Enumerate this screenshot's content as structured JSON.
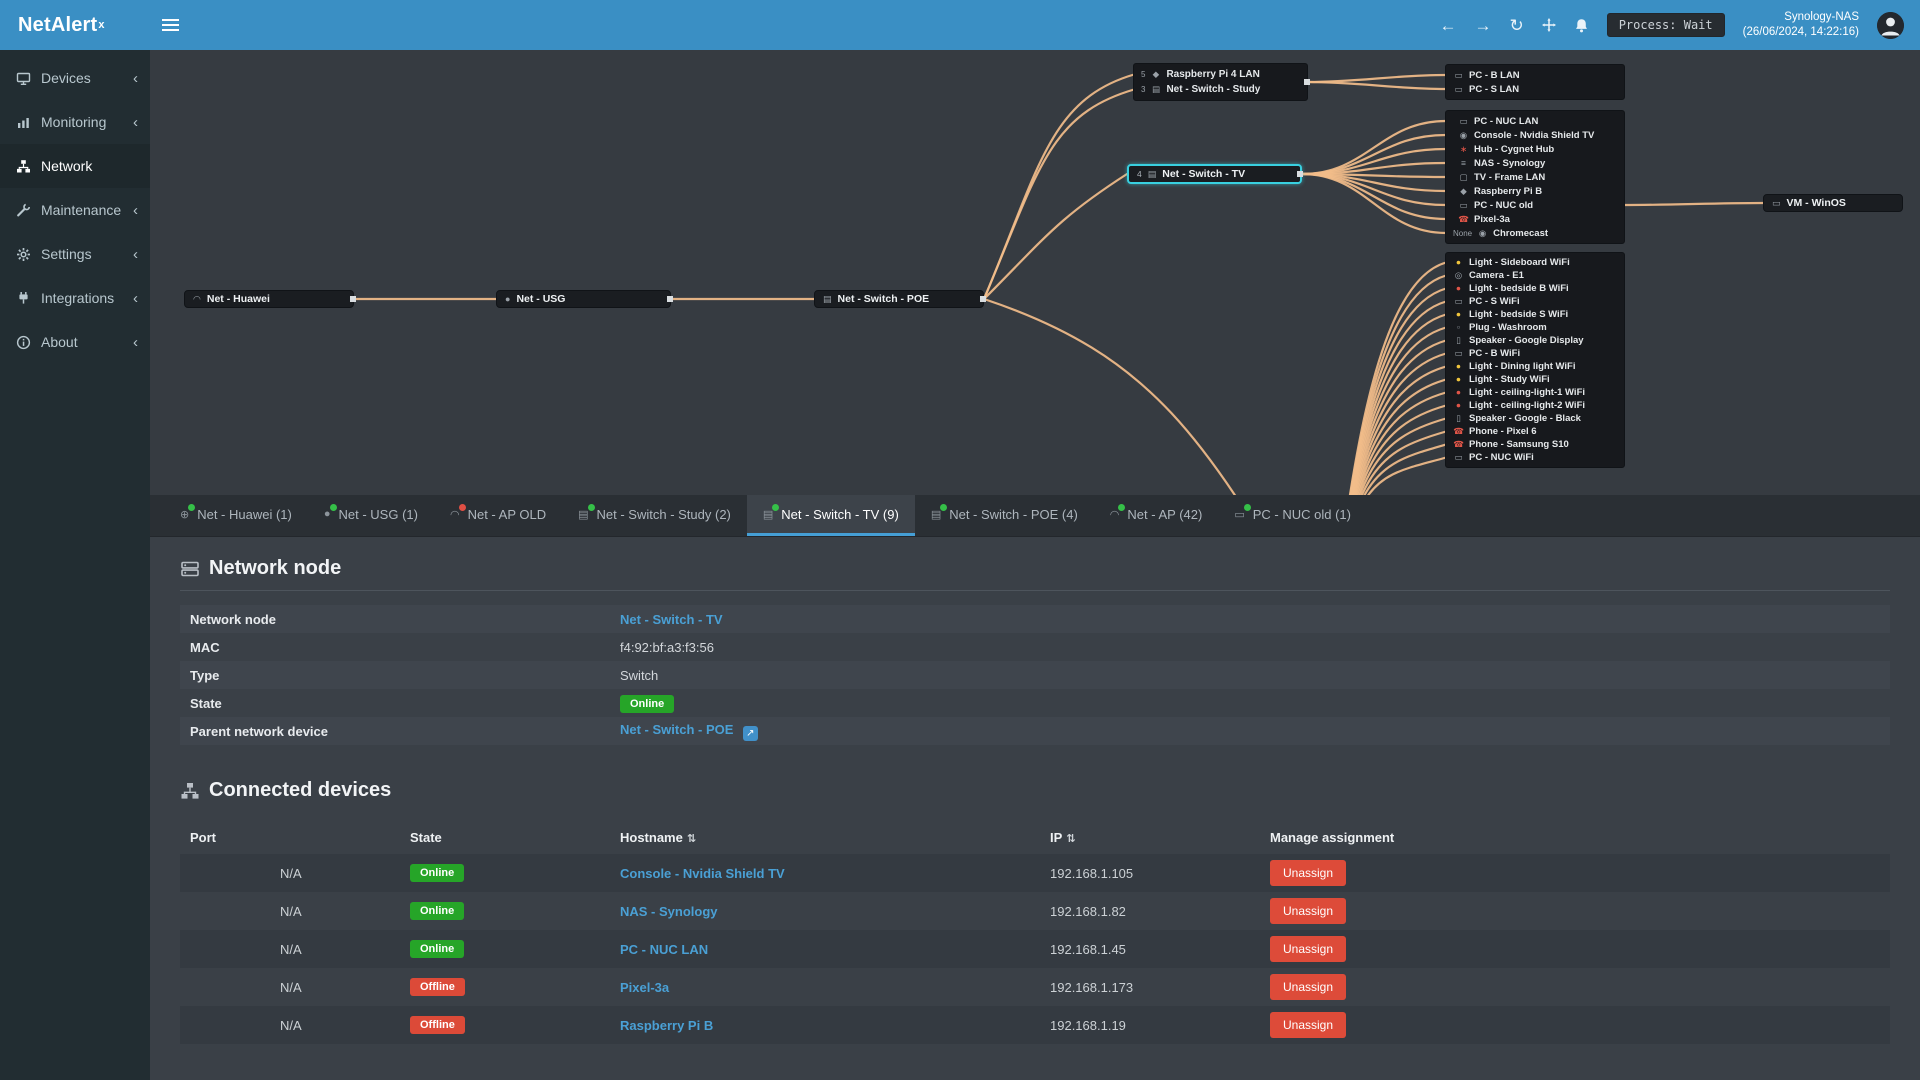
{
  "app": {
    "brand": "NetAlert",
    "brand_sup": "x"
  },
  "topbar": {
    "process_badge": "Process: Wait",
    "server_name": "Synology-NAS",
    "server_time": "(26/06/2024, 14:22:16)"
  },
  "colors": {
    "accent_blue": "#3a8fc4",
    "link": "#4aa0d5",
    "online": "#26a528",
    "offline": "#dc4a38",
    "topology_line": "#f2bd8a",
    "selected_node": "#39d0e0",
    "dot_green": "#35c048",
    "dot_red": "#e04f44"
  },
  "sidebar": {
    "items": [
      {
        "label": "Devices"
      },
      {
        "label": "Monitoring"
      },
      {
        "label": "Network"
      },
      {
        "label": "Maintenance"
      },
      {
        "label": "Settings"
      },
      {
        "label": "Integrations"
      },
      {
        "label": "About"
      }
    ]
  },
  "diagram": {
    "nodes": {
      "huawei": {
        "label": "Net - Huawei"
      },
      "usg": {
        "label": "Net - USG"
      },
      "poe": {
        "label": "Net - Switch - POE"
      },
      "tv": {
        "label": "Net - Switch - TV",
        "port": "4"
      },
      "vm": {
        "label": "VM - WinOS"
      }
    },
    "study_group": [
      {
        "port": "5",
        "label": "Raspberry Pi 4 LAN",
        "icon_class": "ic-pi"
      },
      {
        "port": "3",
        "label": "Net - Switch - Study",
        "icon_class": "ic-switch"
      }
    ],
    "lan_top_group": [
      {
        "label": "PC - B LAN",
        "icon_class": "ic-pc"
      },
      {
        "label": "PC - S LAN",
        "icon_class": "ic-pc"
      }
    ],
    "tv_group": [
      {
        "label": "PC - NUC LAN",
        "icon_class": "ic-pc"
      },
      {
        "label": "Console - Nvidia Shield TV",
        "icon_class": "ic-cast"
      },
      {
        "label": "Hub - Cygnet Hub",
        "icon_class": "ic-hub"
      },
      {
        "label": "NAS - Synology",
        "icon_class": "ic-nas"
      },
      {
        "label": "TV - Frame LAN",
        "icon_class": "ic-tv"
      },
      {
        "label": "Raspberry Pi B",
        "icon_class": "ic-pi"
      },
      {
        "label": "PC - NUC old",
        "icon_class": "ic-pc"
      },
      {
        "label": "Pixel-3a",
        "icon_class": "ic-phone-red"
      },
      {
        "port": "None",
        "label": "Chromecast",
        "icon_class": "ic-cast"
      }
    ],
    "ap_group": [
      {
        "label": "Light - Sideboard WiFi",
        "icon_class": "ic-bulb-yellow"
      },
      {
        "label": "Camera - E1",
        "icon_class": "ic-camera"
      },
      {
        "label": "Light - bedside B WiFi",
        "icon_class": "ic-bulb-red"
      },
      {
        "label": "PC - S WiFi",
        "icon_class": "ic-pc"
      },
      {
        "label": "Light - bedside S WiFi",
        "icon_class": "ic-bulb-yellow"
      },
      {
        "label": "Plug - Washroom",
        "icon_class": "ic-plug"
      },
      {
        "label": "Speaker - Google Display",
        "icon_class": "ic-speaker"
      },
      {
        "label": "PC - B WiFi",
        "icon_class": "ic-pc"
      },
      {
        "label": "Light - Dining light WiFi",
        "icon_class": "ic-bulb-yellow"
      },
      {
        "label": "Light - Study WiFi",
        "icon_class": "ic-bulb-yellow"
      },
      {
        "label": "Light - ceiling-light-1 WiFi",
        "icon_class": "ic-bulb-red"
      },
      {
        "label": "Light - ceiling-light-2 WiFi",
        "icon_class": "ic-bulb-red"
      },
      {
        "label": "Speaker - Google - Black",
        "icon_class": "ic-speaker"
      },
      {
        "label": "Phone - Pixel 6",
        "icon_class": "ic-phone-red"
      },
      {
        "label": "Phone - Samsung S10",
        "icon_class": "ic-phone-red"
      },
      {
        "label": "PC - NUC WiFi",
        "icon_class": "ic-pc"
      }
    ]
  },
  "tabs": [
    {
      "label": "Net - Huawei (1)",
      "dot": "green"
    },
    {
      "label": "Net - USG (1)",
      "dot": "green"
    },
    {
      "label": "Net - AP OLD",
      "dot": "red"
    },
    {
      "label": "Net - Switch - Study (2)",
      "dot": "green"
    },
    {
      "label": "Net - Switch - TV (9)",
      "dot": "green"
    },
    {
      "label": "Net - Switch - POE (4)",
      "dot": "green"
    },
    {
      "label": "Net - AP (42)",
      "dot": "green"
    },
    {
      "label": "PC - NUC old (1)",
      "dot": "green"
    }
  ],
  "node_section": {
    "title": "Network node",
    "fields": [
      {
        "label": "Network node",
        "value": "Net - Switch - TV"
      },
      {
        "label": "MAC",
        "value": "f4:92:bf:a3:f3:56"
      },
      {
        "label": "Type",
        "value": "Switch"
      },
      {
        "label": "State",
        "value": "Online"
      },
      {
        "label": "Parent network device",
        "value": "Net - Switch - POE"
      }
    ]
  },
  "devices_section": {
    "title": "Connected devices",
    "columns": [
      "Port",
      "State",
      "Hostname",
      "IP",
      "Manage assignment"
    ],
    "unassign_label": "Unassign",
    "rows": [
      {
        "port": "N/A",
        "state": "Online",
        "hostname": "Console - Nvidia Shield TV",
        "ip": "192.168.1.105"
      },
      {
        "port": "N/A",
        "state": "Online",
        "hostname": "NAS - Synology",
        "ip": "192.168.1.82"
      },
      {
        "port": "N/A",
        "state": "Online",
        "hostname": "PC - NUC LAN",
        "ip": "192.168.1.45"
      },
      {
        "port": "N/A",
        "state": "Offline",
        "hostname": "Pixel-3a",
        "ip": "192.168.1.173"
      },
      {
        "port": "N/A",
        "state": "Offline",
        "hostname": "Raspberry Pi B",
        "ip": "192.168.1.19"
      }
    ]
  }
}
